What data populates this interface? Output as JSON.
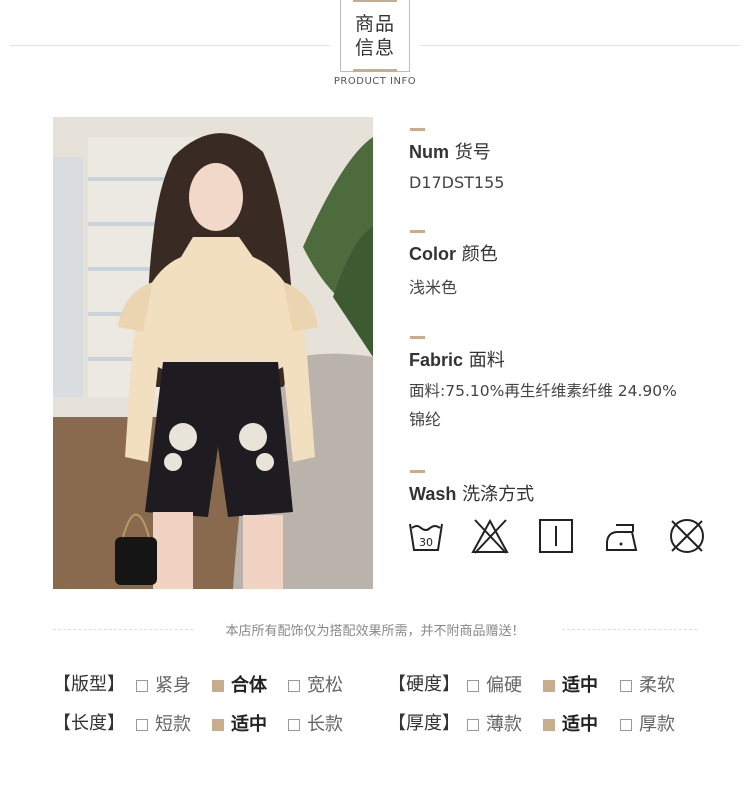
{
  "header": {
    "title_line1": "商品",
    "title_line2": "信息",
    "subtitle": "PRODUCT INFO"
  },
  "info": {
    "num": {
      "label_en": "Num",
      "label_cn": "货号",
      "value": "D17DST155"
    },
    "color": {
      "label_en": "Color",
      "label_cn": "颜色",
      "value": "浅米色"
    },
    "fabric": {
      "label_en": "Fabric",
      "label_cn": "面料",
      "value_line1": "面料:75.10%再生纤维素纤维 24.90%",
      "value_line2": "锦纶"
    },
    "wash": {
      "label_en": "Wash",
      "label_cn": "洗涤方式",
      "icons": [
        "wash-30-icon",
        "no-bleach-icon",
        "tumble-dry-flat-icon",
        "iron-low-icon",
        "no-dry-clean-icon"
      ],
      "wash_temp": "30"
    }
  },
  "note": "本店所有配饰仅为搭配效果所需，并不附商品赠送！",
  "attributes": {
    "fit": {
      "label": "【版型】",
      "options": [
        "紧身",
        "合体",
        "宽松"
      ],
      "selected": "合体"
    },
    "hardness": {
      "label": "【硬度】",
      "options": [
        "偏硬",
        "适中",
        "柔软"
      ],
      "selected": "适中"
    },
    "length": {
      "label": "【长度】",
      "options": [
        "短款",
        "适中",
        "长款"
      ],
      "selected": "适中"
    },
    "thickness": {
      "label": "【厚度】",
      "options": [
        "薄款",
        "适中",
        "厚款"
      ],
      "selected": "适中"
    }
  },
  "colors": {
    "accent": "#c8ad8c",
    "text": "#333333",
    "line": "#e2e2e2"
  }
}
